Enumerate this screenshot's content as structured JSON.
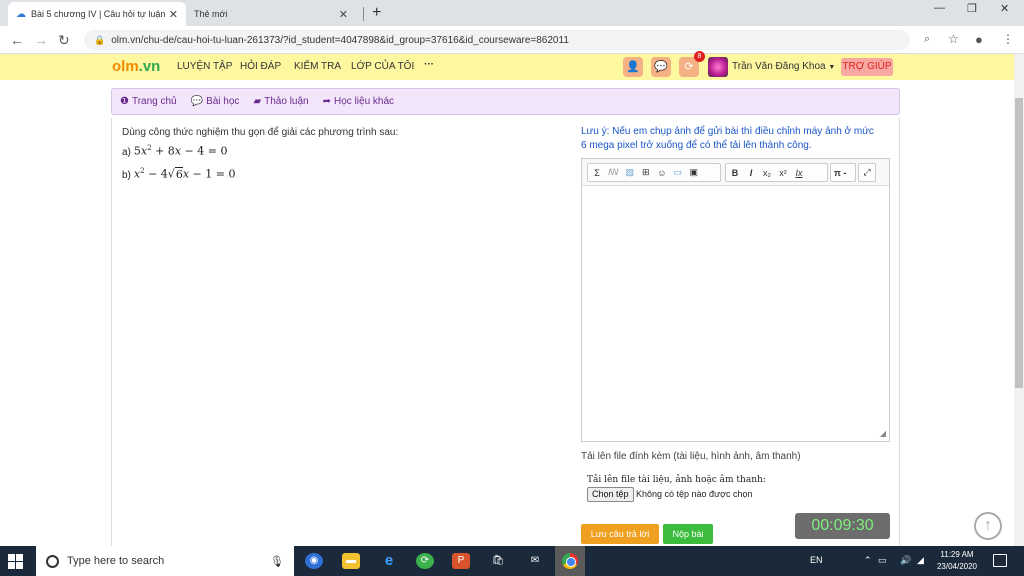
{
  "browser": {
    "tabs": [
      {
        "title": "Bài 5 chương IV | Câu hỏi tự luận",
        "active": true
      },
      {
        "title": "Thẻ mới",
        "active": false
      }
    ],
    "url": "olm.vn/chu-de/cau-hoi-tu-luan-261373/?id_student=4047898&id_group=37616&id_courseware=862011"
  },
  "header": {
    "logo_main": "olm",
    "logo_suffix": ".vn",
    "nav": [
      "LUYỆN TẬP",
      "HỎI ĐÁP",
      "KIỂM TRA",
      "LỚP CỦA TÔI",
      "···"
    ],
    "notification_count": "8",
    "username": "Trần Văn Đăng Khoa",
    "help": "TRỢ GIÚP"
  },
  "breadcrumb": [
    {
      "label": "Trang chủ",
      "icon": "info-icon"
    },
    {
      "label": "Bài học",
      "icon": "comments-icon"
    },
    {
      "label": "Thảo luận",
      "icon": "book-icon"
    },
    {
      "label": "Học liệu khác",
      "icon": "share-icon"
    }
  ],
  "question": {
    "prompt": "Dùng công thức nghiệm thu gọn để giải các phương trình sau:",
    "label_a": "a)",
    "label_b": "b)"
  },
  "answer": {
    "note": "Lưu ý: Nếu em chụp ảnh để gửi bài thì điều chỉnh máy ảnh ở mức 6 mega pixel trở xuống để có thể tải lên thành công.",
    "toolbar": [
      "Σ",
      "ꟿ",
      "▧",
      "⊞",
      "☺",
      "▭",
      "▣",
      "B",
      "I",
      "x₂",
      "x²",
      "Ix",
      "π -",
      "⤢"
    ],
    "upload_label": "Tải lên file đính kèm (tài liệu, hình ảnh, âm thanh)",
    "upload_title": "Tải lên file tài liệu, ảnh hoặc âm thanh:",
    "choose_file": "Chọn tệp",
    "no_file": "Không có tệp nào được chọn",
    "save": "Lưu câu trả lời",
    "submit": "Nộp bài",
    "timer": "00:09:30"
  },
  "taskbar": {
    "search_placeholder": "Type here to search",
    "lang": "EN",
    "time": "11:29 AM",
    "date": "23/04/2020"
  },
  "colors": {
    "header_bg": "#fdf7a0",
    "breadcrumb_bg": "#f3e6fb",
    "note_text": "#1a56c9",
    "save_btn": "#f0a020",
    "submit_btn": "#3cbc3c",
    "timer_bg": "#6d6d6d",
    "timer_text": "#7cf07c"
  }
}
